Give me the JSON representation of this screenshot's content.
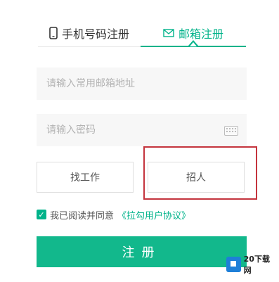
{
  "tabs": {
    "phone_label": "手机号码注册",
    "email_label": "邮箱注册",
    "active": "email"
  },
  "form": {
    "email_placeholder": "请输入常用邮箱地址",
    "password_placeholder": "请输入密码"
  },
  "roles": {
    "job_label": "找工作",
    "hire_label": "招人"
  },
  "agreement": {
    "text": "我已阅读并同意",
    "link": "《拉勾用户协议》",
    "checked": true
  },
  "submit_label": "注册",
  "watermark": "20下载网",
  "colors": {
    "accent": "#00b38a",
    "highlight": "#c4343d",
    "button": "#12b88c"
  },
  "icons": {
    "phone_tab": "phone-icon",
    "email_tab": "envelope-icon",
    "password_field": "keyboard-icon"
  }
}
